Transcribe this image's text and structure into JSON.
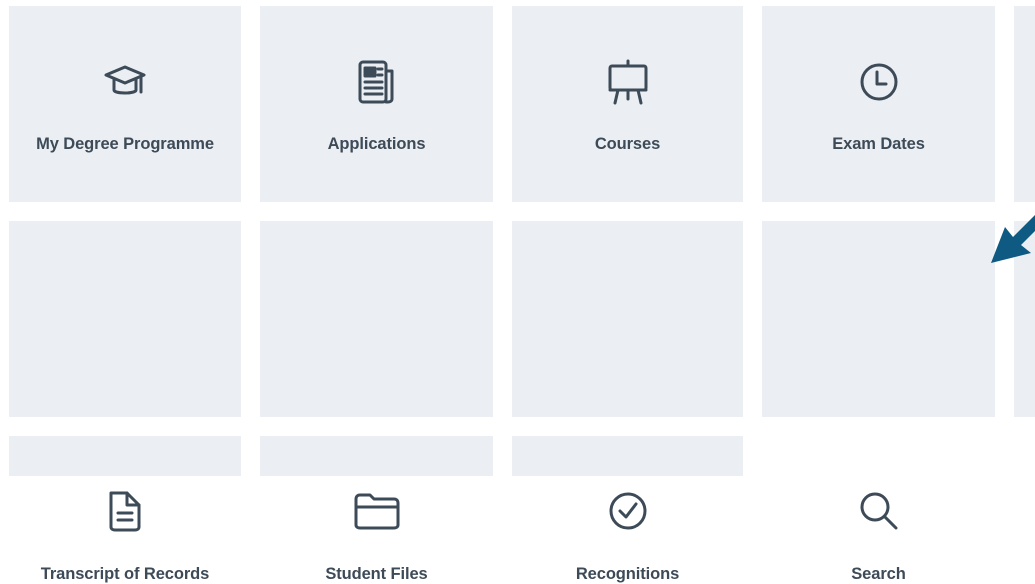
{
  "tiles": {
    "my_degree_programme": {
      "label": "My Degree Programme",
      "icon": "graduation-cap-icon"
    },
    "applications": {
      "label": "Applications",
      "icon": "newspaper-icon"
    },
    "courses": {
      "label": "Courses",
      "icon": "easel-icon"
    },
    "exam_dates": {
      "label": "Exam Dates",
      "icon": "clock-icon"
    },
    "transcript_of_records": {
      "label": "Transcript of Records",
      "icon": "document-icon"
    },
    "student_files": {
      "label": "Student Files",
      "icon": "folder-icon"
    },
    "recognitions": {
      "label": "Recognitions",
      "icon": "check-circle-icon"
    },
    "search": {
      "label": "Search",
      "icon": "search-icon"
    }
  },
  "colors": {
    "tile_background": "#ebeff3",
    "icon_and_text": "#3d4a57",
    "arrow": "#0e5a82"
  }
}
